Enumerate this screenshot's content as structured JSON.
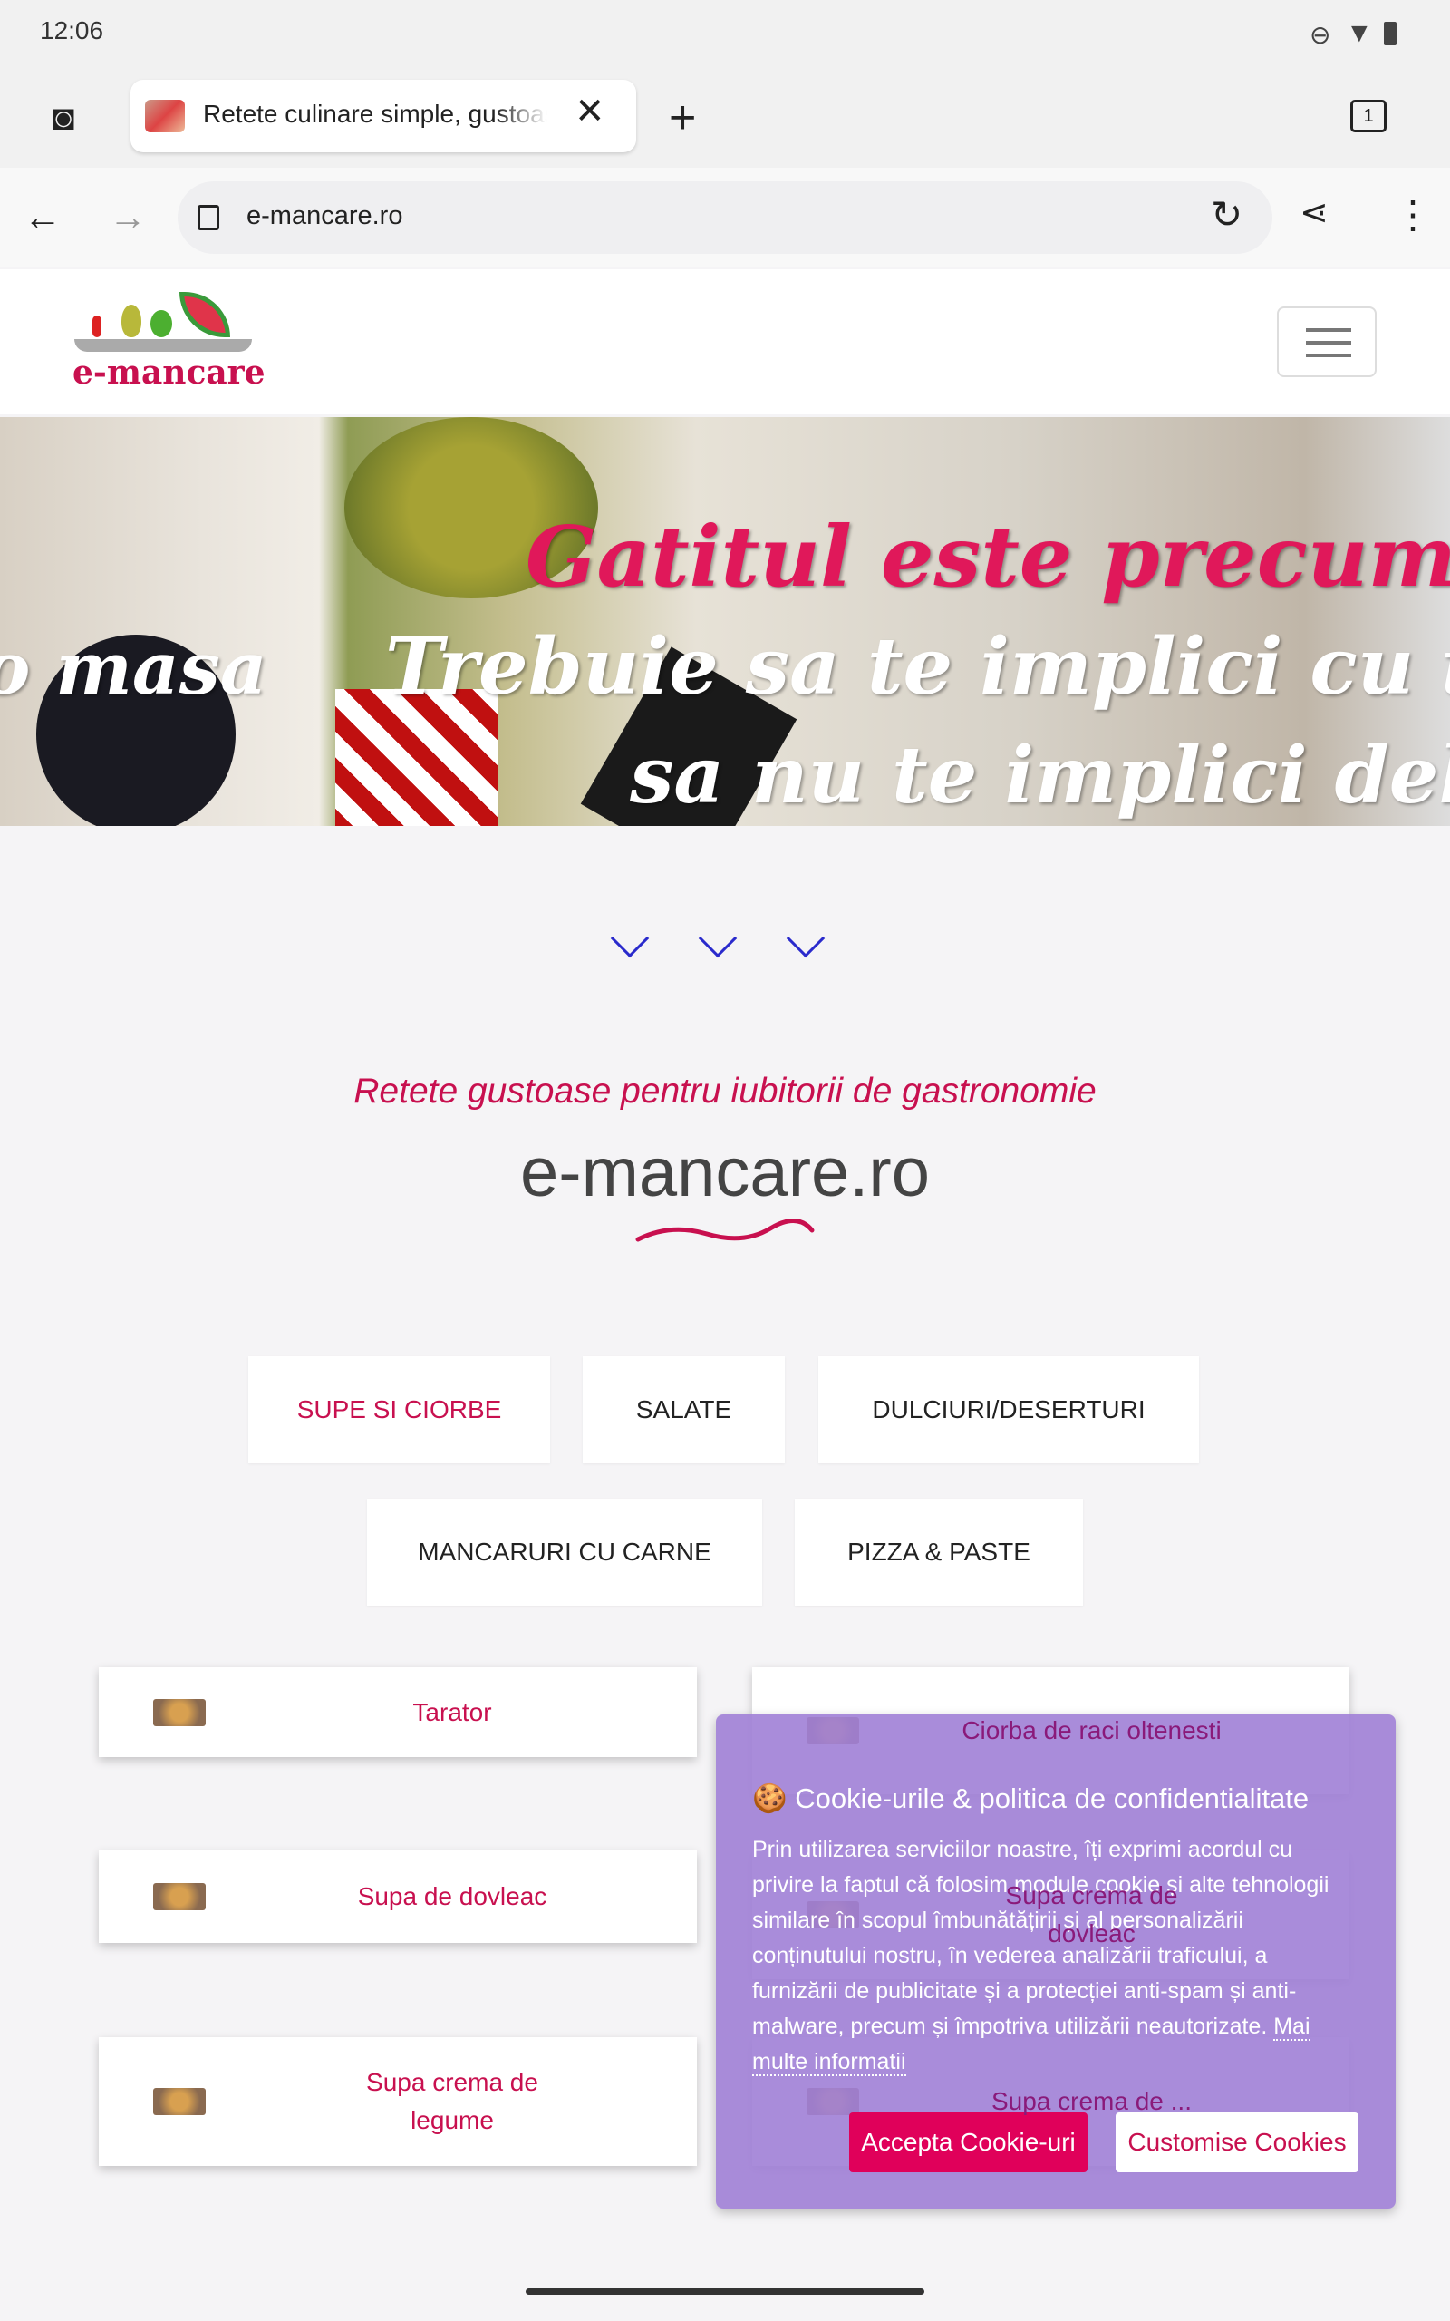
{
  "status_bar": {
    "time": "12:06",
    "icons": [
      "dnd-icon",
      "wifi-icon",
      "battery-icon"
    ]
  },
  "browser": {
    "tab_title": "Retete culinare simple, gustoase",
    "tab_count": "1",
    "url": "e-mancare.ro"
  },
  "site": {
    "logo_text": "e-mancare",
    "hero": {
      "line1": "Gatitul este precum iub",
      "line2_left": "o masa",
      "line2": "Trebuie sa te implici cu to",
      "line3": "sa nu te implici delo"
    },
    "subtitle": "Retete gustoase pentru iubitorii de gastronomie",
    "title": "e-mancare.ro",
    "categories": [
      {
        "label": "SUPE SI CIORBE",
        "active": true
      },
      {
        "label": "SALATE"
      },
      {
        "label": "DULCIURI/DESERTURI"
      },
      {
        "label": "MANCARURI CU CARNE"
      },
      {
        "label": "PIZZA & PASTE"
      }
    ],
    "recipes_left": [
      "Tarator",
      "Supa de dovleac",
      "Supa crema de legume"
    ],
    "recipes_right": [
      "Ciorba de raci oltenesti",
      "Supa crema de dovleac",
      "Supa crema de ..."
    ]
  },
  "cookie": {
    "title": "Cookie-urile & politica de confidentialitate",
    "body": "Prin utilizarea serviciilor noastre, îți exprimi acordul cu privire la faptul că folosim module cookie și alte tehnologii similare în scopul îmbunătățirii și al personalizării conținutului nostru, în vederea analizării traficului, a furnizării de publicitate și a protecției anti-spam și anti-malware, precum și împotriva utilizării neautorizate. ",
    "more": "Mai multe informatii",
    "accept": "Accepta Cookie-uri",
    "customise": "Customise Cookies"
  },
  "colors": {
    "brand": "#c8104f",
    "accept": "#e0005a",
    "cookie_bg": "#a080d6",
    "chevron": "#2a2acc"
  }
}
